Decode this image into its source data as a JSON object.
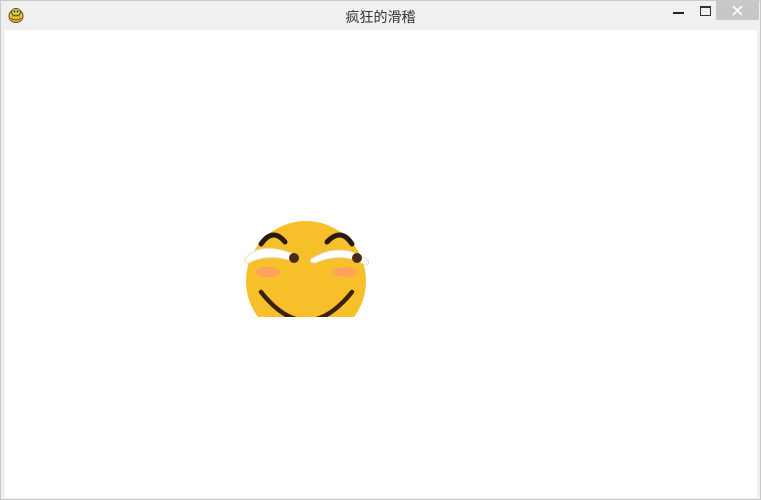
{
  "window": {
    "title": "疯狂的滑稽",
    "app_icon": "pygame-snake-icon",
    "controls": {
      "minimize_icon": "minimize-icon",
      "maximize_icon": "maximize-icon",
      "close_icon": "close-icon"
    }
  },
  "canvas": {
    "background": "#ffffff",
    "sprite": {
      "name": "huaji-smiley-face",
      "face_color": "#f7c02a",
      "blush_color": "#ff9a6a",
      "eye_white_color": "#ffffff",
      "pupil_color": "#4a2a10",
      "brow_color": "#2b1a0e",
      "mouth_color": "#3b220f"
    }
  }
}
